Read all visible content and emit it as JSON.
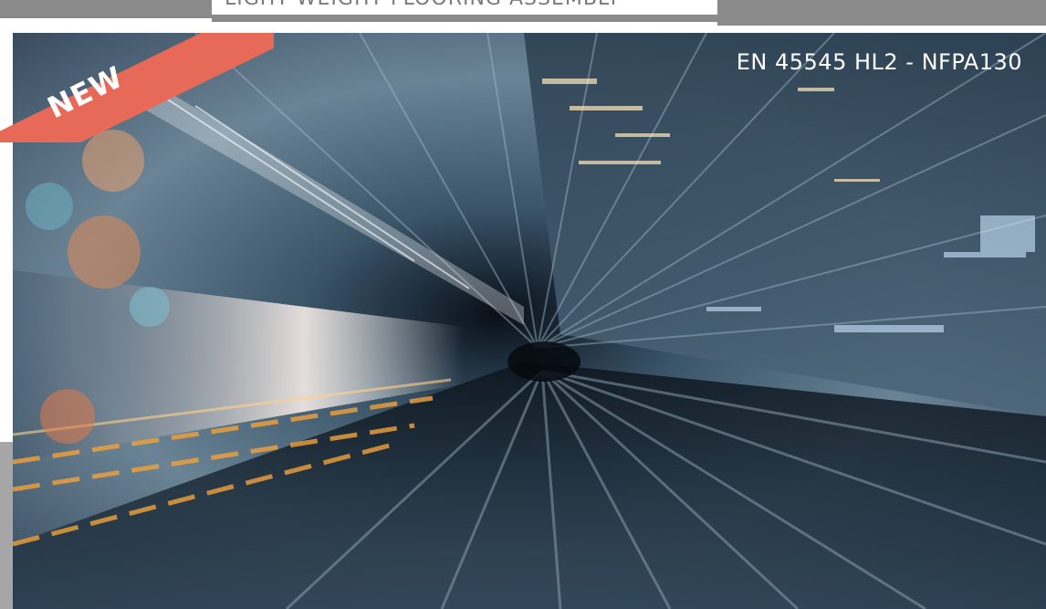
{
  "header": {
    "title": "LIGHT WEIGHT FLOORING ASSEMBLY"
  },
  "badge": {
    "label": "NEW",
    "color": "#e66a57"
  },
  "standards": {
    "label": "EN 45545 HL2 - NFPA130"
  },
  "colors": {
    "band": "#8a8a8a",
    "photo_dark": "#1f2f3f",
    "photo_light": "#f4e9e2"
  }
}
